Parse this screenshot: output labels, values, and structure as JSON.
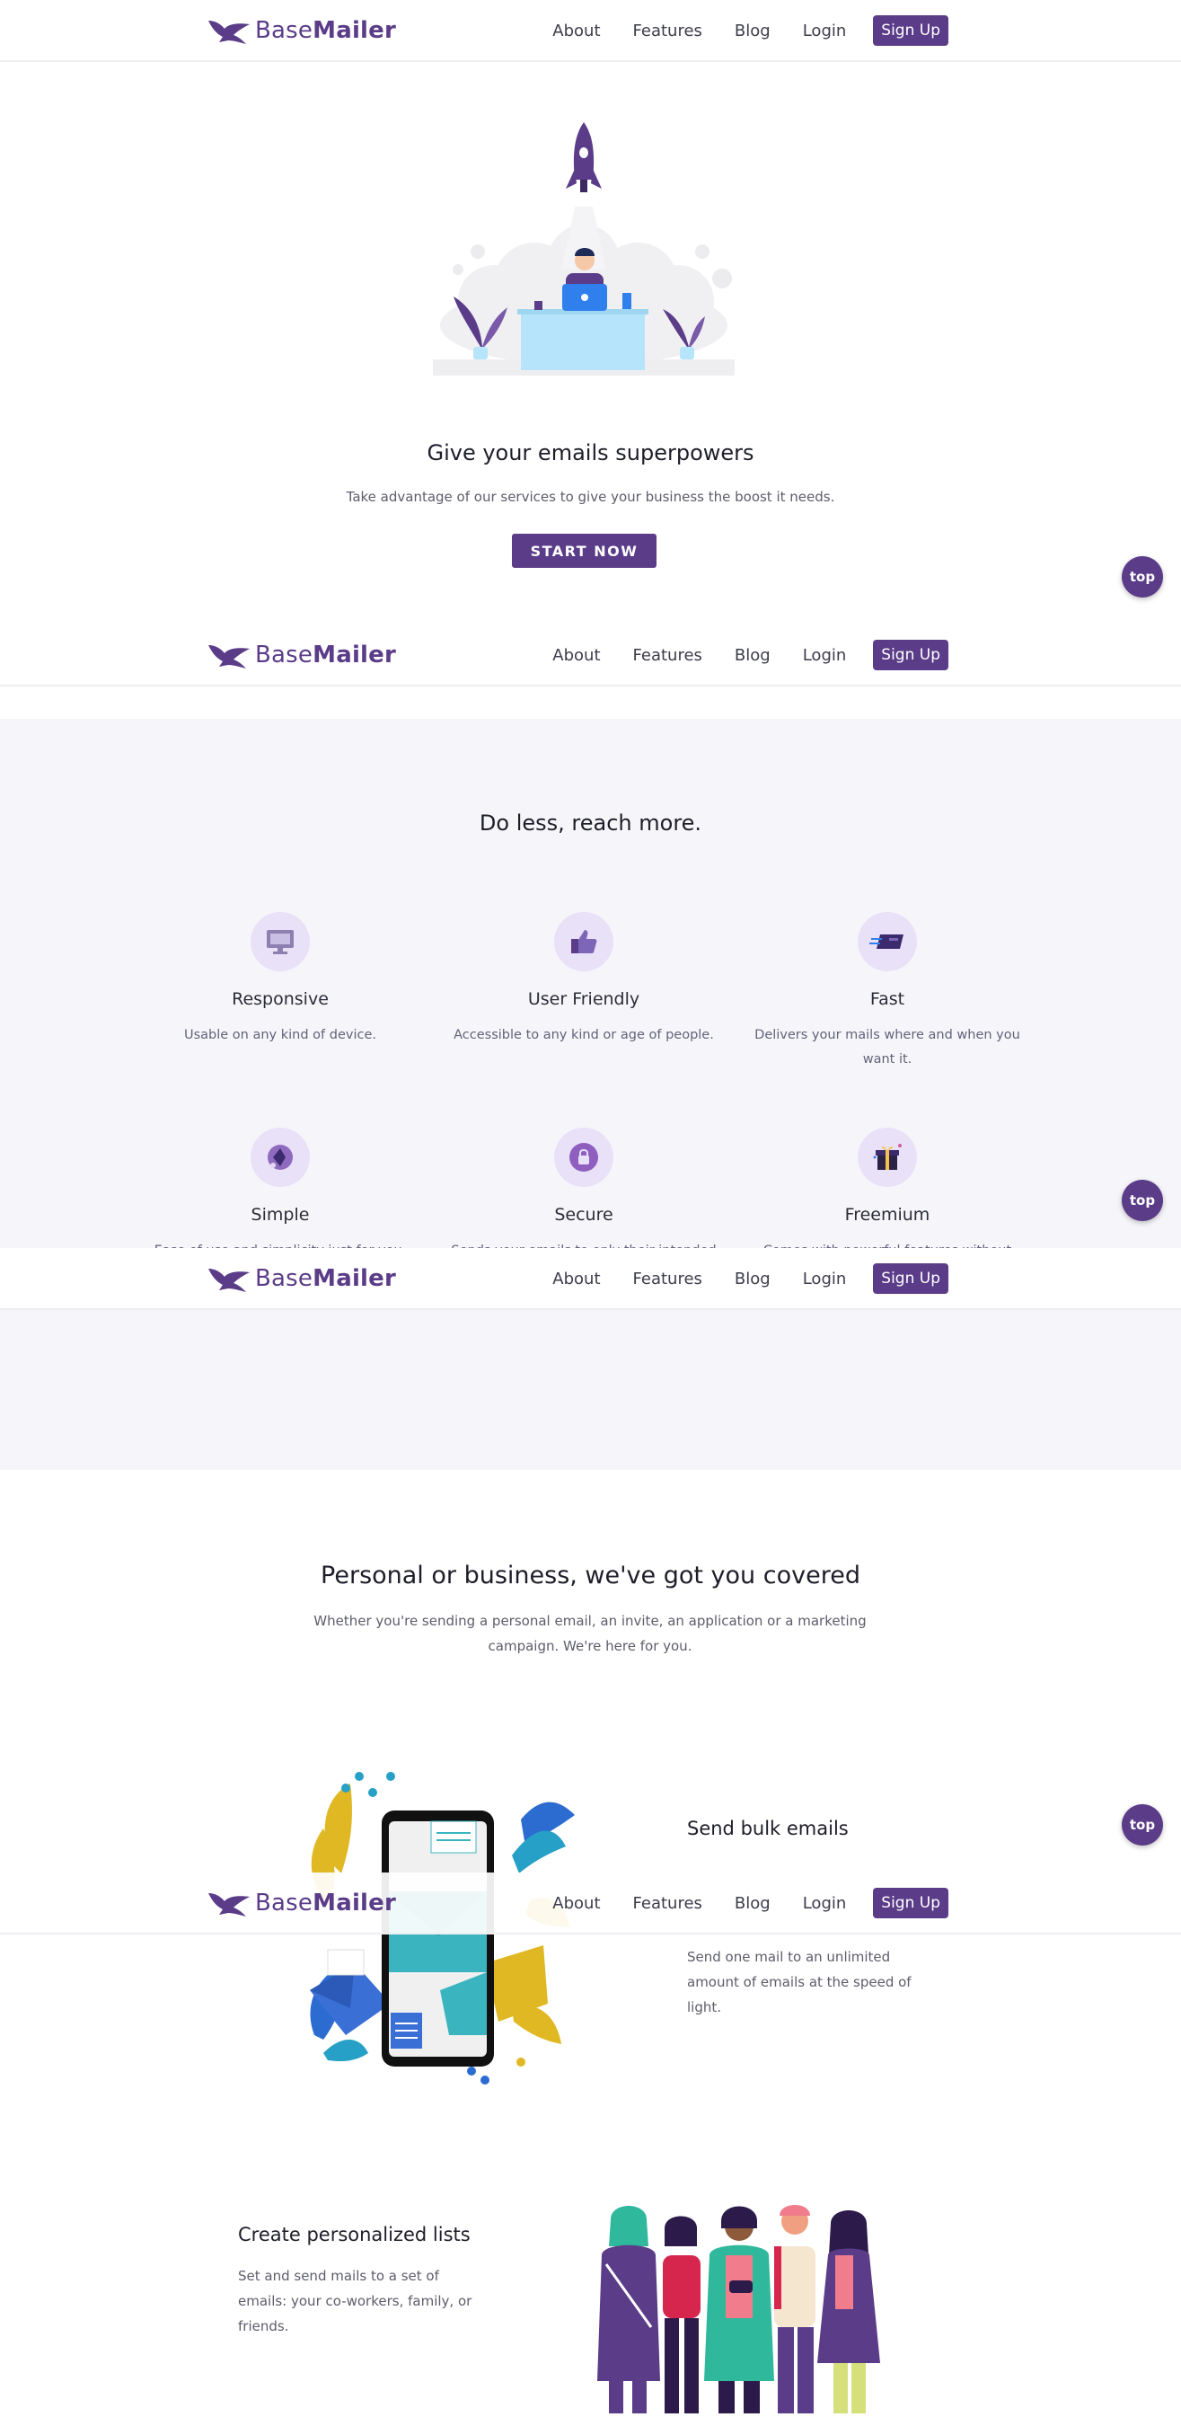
{
  "nav": {
    "brand_part1": "Base",
    "brand_part2": "Mailer",
    "links": [
      "About",
      "Features",
      "Blog",
      "Login"
    ],
    "signup": "Sign Up"
  },
  "top_button": "top",
  "hero": {
    "title": "Give your emails superpowers",
    "subtitle": "Take advantage of our services to give your business the boost it needs.",
    "cta": "START NOW"
  },
  "features": {
    "heading": "Do less, reach more.",
    "items": [
      {
        "title": "Responsive",
        "desc": "Usable on any kind of device.",
        "icon": "monitor-icon"
      },
      {
        "title": "User Friendly",
        "desc": "Accessible to any kind or age of people.",
        "icon": "thumbs-up-icon"
      },
      {
        "title": "Fast",
        "desc": "Delivers your mails where and when you want it.",
        "icon": "speed-card-icon"
      },
      {
        "title": "Simple",
        "desc": "Ease of use and simplicity just for you.",
        "icon": "diamond-icon"
      },
      {
        "title": "Secure",
        "desc": "Sends your emails to only their intended recipients. No interference.",
        "icon": "lock-icon"
      },
      {
        "title": "Freemium",
        "desc": "Comes with powerful features without paying a dime on start.",
        "icon": "gift-icon"
      }
    ]
  },
  "covered": {
    "heading": "Personal or business, we've got you covered",
    "text": "Whether you're sending a personal email, an invite, an application or a marketing campaign. We're here for you."
  },
  "bulk": {
    "title": "Send bulk emails",
    "text": "Send one mail to an unlimited amount of emails at the speed of light."
  },
  "lists": {
    "title": "Create personalized lists",
    "text": "Set and send mails to a set of emails: your co-workers, family, or friends."
  },
  "colors": {
    "accent": "#5b3c88",
    "section_bg": "#f6f6fa"
  }
}
